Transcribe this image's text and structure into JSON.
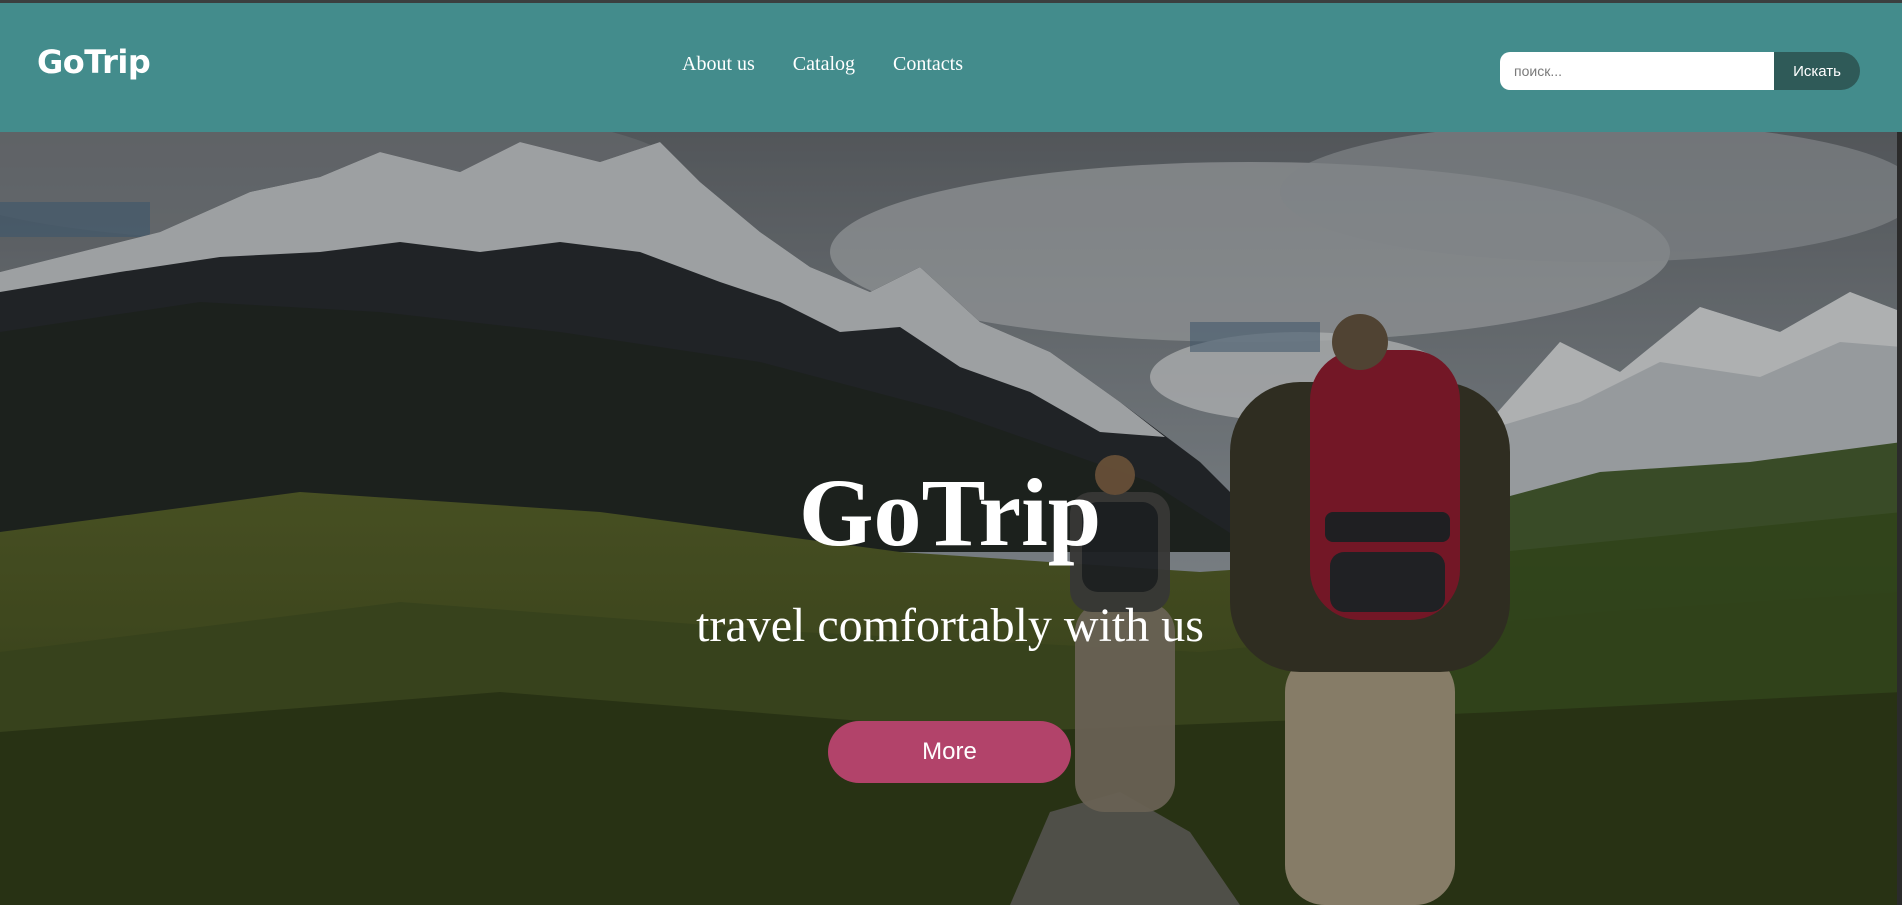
{
  "header": {
    "logo": "GoTrip",
    "nav": [
      "About us",
      "Catalog",
      "Contacts"
    ],
    "search": {
      "placeholder": "поиск...",
      "value": "",
      "button_label": "Искать"
    }
  },
  "hero": {
    "title": "GoTrip",
    "subtitle": "travel comfortably with us",
    "button_label": "More"
  },
  "colors": {
    "header_bg": "#438c8c",
    "search_button": "#2f5a58",
    "accent_button": "#b2436a"
  }
}
